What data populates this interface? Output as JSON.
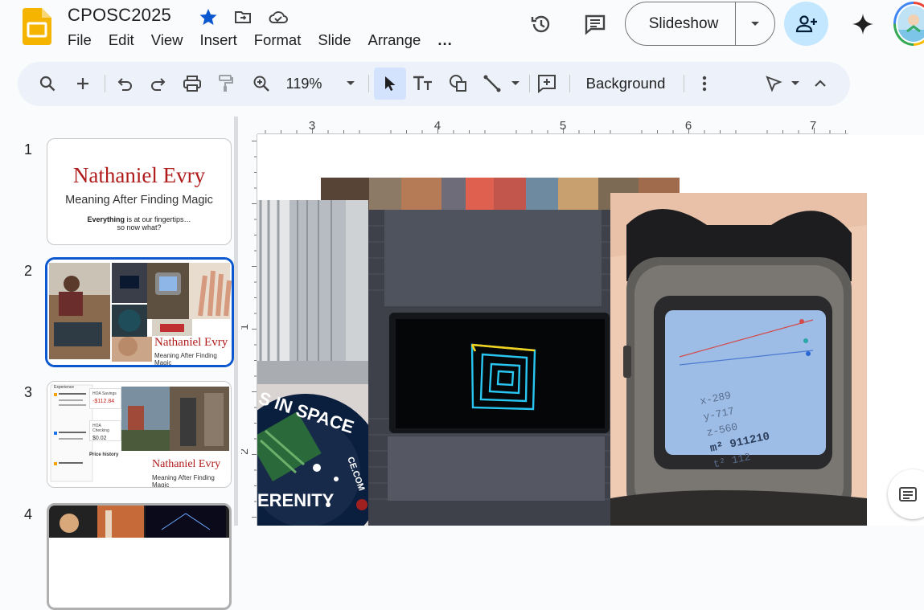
{
  "app": {
    "doc_title": "CPOSC2025",
    "menu": [
      "File",
      "Edit",
      "View",
      "Insert",
      "Format",
      "Slide",
      "Arrange",
      "..."
    ],
    "slideshow_label": "Slideshow",
    "icons": {
      "logo": "google-slides-logo",
      "star": "star-icon",
      "move": "move-to-folder-icon",
      "cloud": "cloud-saved-icon",
      "history": "version-history-icon",
      "comments": "comments-icon",
      "share": "share-add-person-icon",
      "gemini": "gemini-sparkle-icon"
    },
    "colors": {
      "accent": "#0b57d0",
      "star": "#0b57d0",
      "share_bg": "#c2e7ff",
      "toolbar_bg": "#edf2fa",
      "title_red": "#b01c1c"
    }
  },
  "toolbar": {
    "zoom": "119%",
    "background_label": "Background"
  },
  "ruler": {
    "horizontal": [
      "3",
      "4",
      "5",
      "6",
      "7"
    ],
    "vertical": [
      "1",
      "2"
    ]
  },
  "filmstrip": {
    "slides": [
      {
        "number": "1",
        "title": "Nathaniel Evry",
        "subtitle": "Meaning After Finding Magic",
        "line1_bold": "Everything",
        "line1_rest": " is at our fingertips…",
        "line2": "so now what?"
      },
      {
        "number": "2",
        "title": "Nathaniel Evry",
        "subtitle": "Meaning After Finding Magic"
      },
      {
        "number": "3",
        "title": "Nathaniel Evry",
        "subtitle": "Meaning After Finding Magic",
        "hoa_label": "HOA Savings",
        "hoa_value": "-$112.84",
        "checking_label": "HOA Checking",
        "checking_value": "$0.02",
        "price_history": "Price history",
        "experience": "Experience"
      },
      {
        "number": "4"
      }
    ]
  },
  "canvas": {
    "patch_text_top": "S IN SPACE",
    "patch_text_bottom": "ERENITY",
    "patch_text_side": "CE.COM",
    "watch_readings": [
      "x-289",
      "y-717",
      "z-560",
      "m² 911210",
      "t² 112"
    ]
  }
}
